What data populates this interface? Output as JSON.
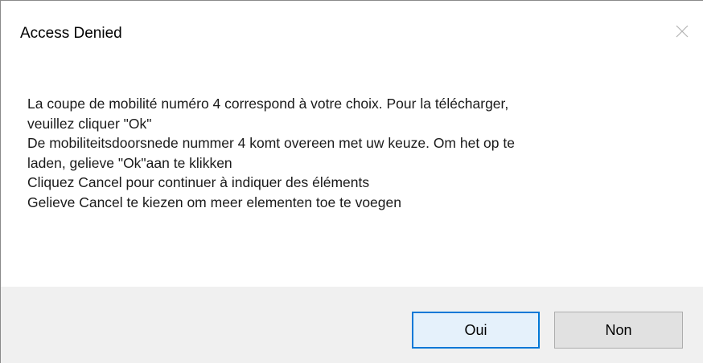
{
  "dialog": {
    "title": "Access Denied",
    "close_icon": "close-icon"
  },
  "message": {
    "lines": [
      "La coupe de mobilité numéro 4 correspond à votre choix. Pour la télécharger,",
      "veuillez cliquer \"Ok\"",
      "De mobiliteitsdoorsnede nummer 4 komt overeen met uw keuze. Om het op te",
      "laden, gelieve \"Ok\"aan te klikken",
      "Cliquez Cancel pour continuer à indiquer des éléments",
      "Gelieve Cancel te kiezen om meer elementen toe te voegen"
    ]
  },
  "buttons": {
    "yes_label": "Oui",
    "no_label": "Non"
  },
  "colors": {
    "accent": "#0078d7",
    "footer_bg": "#f0f0f0",
    "default_button_bg": "#e5f1fb",
    "button_bg": "#e1e1e1"
  }
}
